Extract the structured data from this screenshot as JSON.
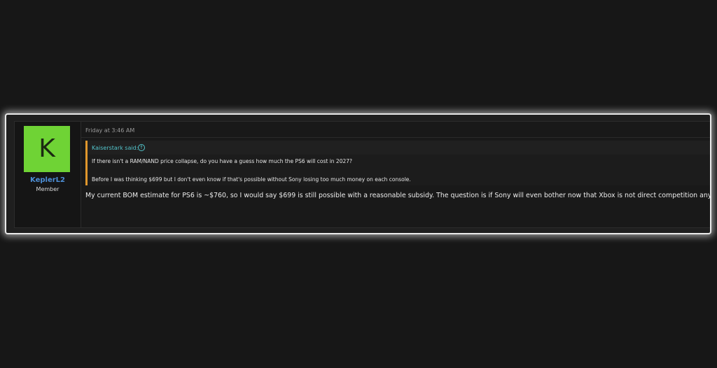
{
  "post": {
    "user": {
      "avatar_letter": "K",
      "avatar_color": "#6fd335",
      "name": "KeplerL2",
      "title": "Member"
    },
    "date": "Friday at 3:46 AM",
    "quote": {
      "author_label": "Kaiserstark said:",
      "jump_icon": "arrow-up-circle-icon",
      "accent_color": "#e0972c",
      "lines": [
        "If there isn't a RAM/NAND price collapse, do you have a guess how much the PS6 will cost in 2027?",
        "Before I was thinking $699 but I don't even know if that's possible without Sony losing too much money on each console."
      ]
    },
    "body": "My current BOM estimate for PS6 is ~$760, so I would say $699 is still possible with a reasonable subsidy. The question is if Sony will even bother now that Xbox is not direct competition anymore."
  }
}
